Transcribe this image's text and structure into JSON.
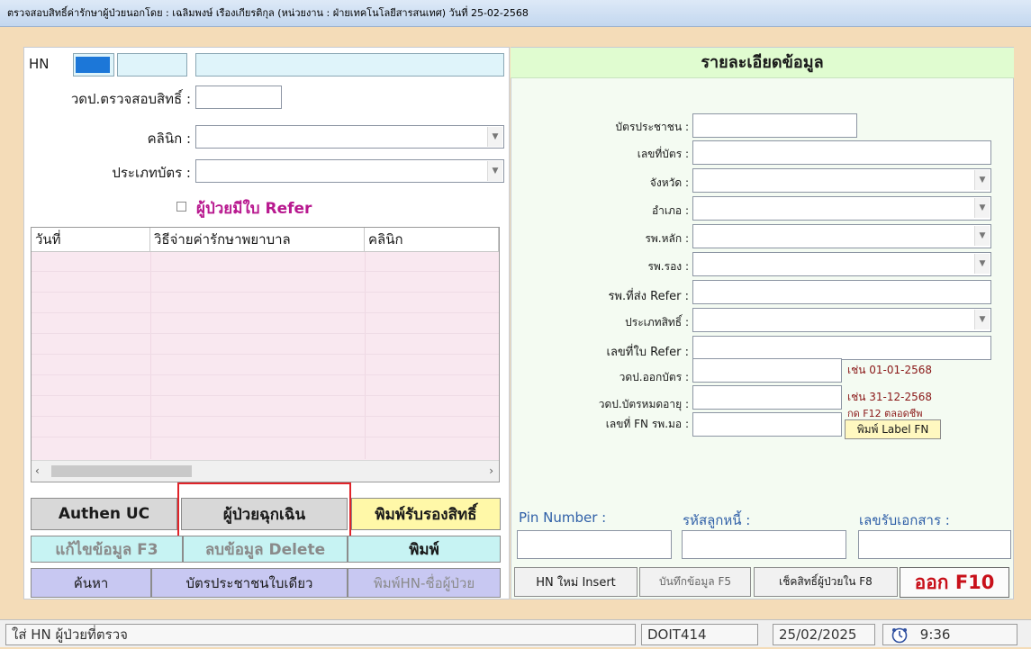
{
  "window": {
    "title": "ตรวจสอบสิทธิ์ค่ารักษาผู้ป่วยนอกโดย : เฉลิมพงษ์ เรืองเกียรติกุล (หน่วยงาน : ฝ่ายเทคโนโลยีสารสนเทศ) วันที่ 25-02-2568"
  },
  "left": {
    "hn_label": "HN",
    "hn_value": "",
    "name_value": "",
    "check_date_label": "วดป.ตรวจสอบสิทธิ์ :",
    "clinic_label": "คลินิก :",
    "card_type_label": "ประเภทบัตร :",
    "refer_checkbox_label": "ผู้ป่วยมีใบ Refer",
    "refer_checked": false,
    "grid": {
      "columns": [
        "วันที่",
        "วิธีจ่ายค่ารักษาพยาบาล",
        "คลินิก"
      ],
      "rows": []
    }
  },
  "right": {
    "header": "รายละเอียดข้อมูล",
    "fields": {
      "id_card_label": "บัตรประชาชน :",
      "card_no_label": "เลขที่บัตร :",
      "province_label": "จังหวัด :",
      "district_label": "อำเภอ :",
      "main_hosp_label": "รพ.หลัก :",
      "sub_hosp_label": "รพ.รอง :",
      "refer_hosp_label": "รพ.ที่ส่ง Refer :",
      "right_type_label": "ประเภทสิทธิ์ :",
      "refer_no_label": "เลขที่ใบ Refer :",
      "issue_date_label": "วดป.ออกบัตร :",
      "expire_date_label": "วดป.บัตรหมดอายุ :",
      "fn_no_label": "เลขที่ FN รพ.มอ :"
    },
    "hints": {
      "issue_example": "เช่น 01-01-2568",
      "expire_example": "เช่น 31-12-2568",
      "f12_hint": "กด F12 ตลอดชีพ"
    },
    "print_label_fn_button": "พิมพ์ Label FN"
  },
  "buttons": {
    "authen_uc": "Authen UC",
    "emergency": "ผู้ป่วยฉุกเฉิน",
    "print_cert": "พิมพ์รับรองสิทธิ์",
    "edit_f3": "แก้ไขข้อมูล F3",
    "delete": "ลบข้อมูล Delete",
    "print": "พิมพ์",
    "search": "ค้นหา",
    "single_id": "บัตรประชาชนใบเดียว",
    "print_hn_name": "พิมพ์HN-ชื่อผู้ป่วย",
    "new_hn": "HN ใหม่ Insert",
    "save_f5": "บันทึกข้อมูล F5",
    "check_f8": "เช็คสิทธิ์ผู้ป่วยใน F8",
    "exit_f10": "ออก F10"
  },
  "bottom_fields": {
    "pin_label": "Pin Number :",
    "debtor_label": "รหัสลูกหนี้ :",
    "doc_no_label": "เลขรับเอกสาร :"
  },
  "statusbar": {
    "message": "ใส่ HN ผู้ป่วยที่ตรวจ",
    "user": "DOIT414",
    "date": "25/02/2025",
    "time": "9:36"
  },
  "colors": {
    "highlight_border": "#e0242a",
    "exit_text": "#c8101a",
    "refer_text": "#b8198f",
    "hint_text": "#8a1818",
    "grid_bg": "#f9e8f0"
  }
}
